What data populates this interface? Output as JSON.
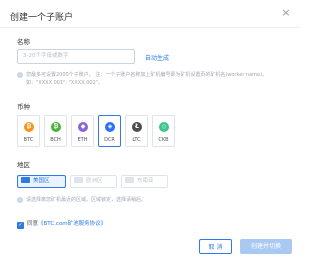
{
  "dialog": {
    "title": "创建一个子账户",
    "close_glyph": "×"
  },
  "name_section": {
    "label": "名称",
    "placeholder": "3-20个字母或数字",
    "auto_generate": "自动生成",
    "hint_line1": "您最多可设置2000个子账户。 注：一个子账户名称加上矿机编号即为矿机设置页的矿机名(worker name)。",
    "hint_line2": "如：\"XXXX.001\", \"XXXX.002\"。"
  },
  "currency_section": {
    "label": "币种",
    "coins": [
      {
        "label": "BTC",
        "glyph": "₿",
        "color": "#f7931a",
        "active": false
      },
      {
        "label": "BCH",
        "glyph": "₿",
        "color": "#49b13f",
        "active": false
      },
      {
        "label": "ETH",
        "glyph": "◆",
        "color": "#8a65d7",
        "active": false
      },
      {
        "label": "DCR",
        "glyph": "◈",
        "color": "#2970ff",
        "active": true
      },
      {
        "label": "LTC",
        "glyph": "Ł",
        "color": "#4d4d4d",
        "active": false
      },
      {
        "label": "CKB",
        "glyph": "◇",
        "color": "#3cc68a",
        "active": false
      }
    ]
  },
  "region_section": {
    "label": "地区",
    "regions": [
      {
        "label": "美国区",
        "active": true
      },
      {
        "label": "欧洲区",
        "active": false
      },
      {
        "label": "东南亚",
        "active": false
      }
    ],
    "hint": "请选择离您矿机最近的区域。区域锁定，选择请稍后。"
  },
  "agreement": {
    "checked": true,
    "prefix": "同意",
    "link": "《BTC.com矿池服务协议》"
  },
  "buttons": {
    "cancel": "取 消",
    "create": "创建并切换"
  }
}
